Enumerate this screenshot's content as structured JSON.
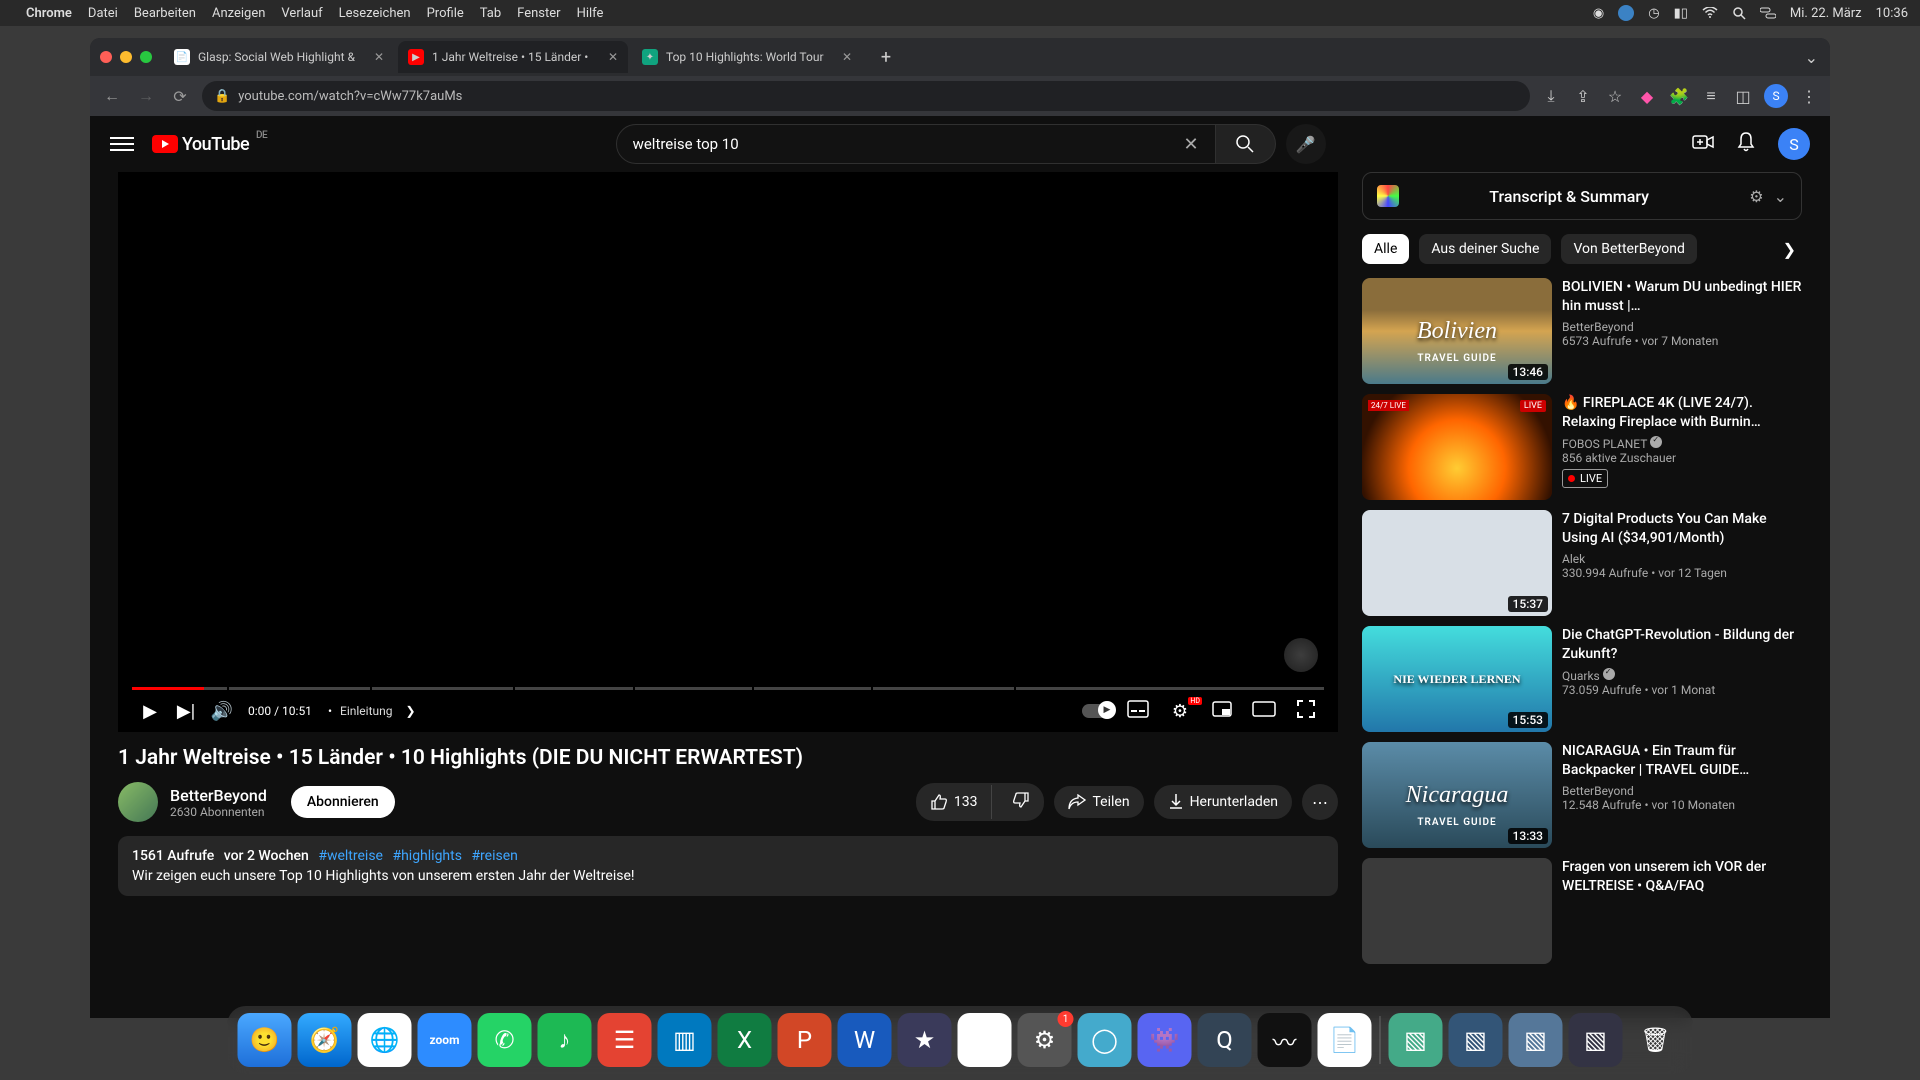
{
  "menubar": {
    "app": "Chrome",
    "items": [
      "Datei",
      "Bearbeiten",
      "Anzeigen",
      "Verlauf",
      "Lesezeichen",
      "Profile",
      "Tab",
      "Fenster",
      "Hilfe"
    ],
    "date": "Mi. 22. März",
    "time": "10:36"
  },
  "tabs": [
    {
      "title": "Glasp: Social Web Highlight &",
      "active": false
    },
    {
      "title": "1 Jahr Weltreise • 15 Länder •",
      "active": true
    },
    {
      "title": "Top 10 Highlights: World Tour",
      "active": false
    }
  ],
  "url": "youtube.com/watch?v=cWw77k7auMs",
  "youtube": {
    "country": "DE",
    "search": "weltreise top 10",
    "avatar": "S"
  },
  "player": {
    "current": "0:00",
    "total": "10:51",
    "chapter": "Einleitung",
    "hd": "HD"
  },
  "video": {
    "title": "1 Jahr Weltreise • 15 Länder • 10 Highlights (DIE DU NICHT ERWARTEST)",
    "channel": "BetterBeyond",
    "subs": "2630 Abonnenten",
    "subscribe": "Abonnieren",
    "likes": "133",
    "share": "Teilen",
    "download": "Herunterladen"
  },
  "description": {
    "views": "1561 Aufrufe",
    "age": "vor 2 Wochen",
    "tags": [
      "#weltreise",
      "#highlights",
      "#reisen"
    ],
    "text": "Wir zeigen euch unsere Top 10 Highlights von unserem ersten Jahr der Weltreise!"
  },
  "transcript": {
    "title": "Transcript & Summary"
  },
  "filters": [
    "Alle",
    "Aus deiner Suche",
    "Von BetterBeyond"
  ],
  "related": [
    {
      "title": "BOLIVIEN • Warum DU unbedingt HIER hin musst |…",
      "channel": "BetterBeyond",
      "views": "6573 Aufrufe",
      "age": "vor 7 Monaten",
      "duration": "13:46",
      "ov": "Bolivien",
      "tg": "TRAVEL GUIDE"
    },
    {
      "title": "🔥 FIREPLACE 4K (LIVE 24/7). Relaxing Fireplace with Burnin…",
      "channel": "FOBOS PLANET",
      "views": "856 aktive Zuschauer",
      "live": true,
      "liveLabelTag": "24/7 LIVE",
      "liveLabel": "LIVE",
      "liveNow": "LIVE",
      "verified": true
    },
    {
      "title": "7 Digital Products You Can Make Using AI ($34,901/Month)",
      "channel": "Alek",
      "views": "330.994 Aufrufe",
      "age": "vor 12 Tagen",
      "duration": "15:37"
    },
    {
      "title": "Die ChatGPT-Revolution - Bildung der Zukunft?",
      "channel": "Quarks",
      "views": "73.059 Aufrufe",
      "age": "vor 1 Monat",
      "duration": "15:53",
      "verified": true,
      "ov": "NIE WIEDER LERNEN"
    },
    {
      "title": "NICARAGUA • Ein Traum für Backpacker | TRAVEL GUIDE…",
      "channel": "BetterBeyond",
      "views": "12.548 Aufrufe",
      "age": "vor 10 Monaten",
      "duration": "13:33",
      "ov": "Nicaragua",
      "tg": "TRAVEL GUIDE"
    },
    {
      "title": "Fragen von unserem ich VOR der WELTREISE • Q&A/FAQ"
    }
  ]
}
